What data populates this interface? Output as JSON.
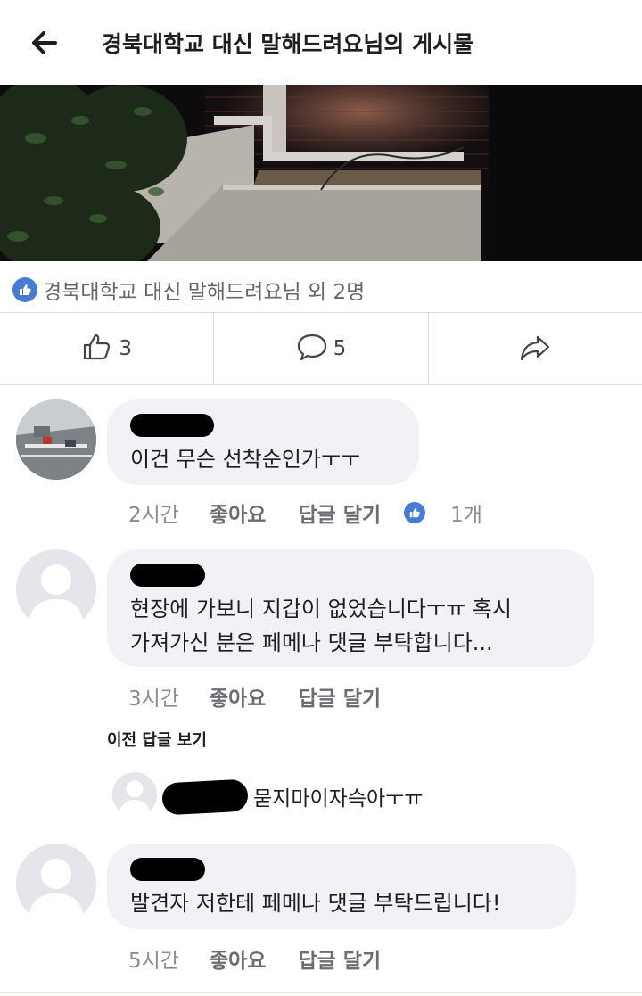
{
  "header": {
    "title": "경북대학교 대신 말해드려요님의 게시물"
  },
  "reactions": {
    "summary": "경북대학교 대신 말해드려요님 외 2명"
  },
  "actions": {
    "like_count": "3",
    "comment_count": "5"
  },
  "comments": [
    {
      "text": "이건 무슨 선착순인가ㅜㅜ",
      "time": "2시간",
      "like_label": "좋아요",
      "reply_label": "답글 달기",
      "like_count": "1개"
    },
    {
      "text_line1": "현장에 가보니 지갑이 없었습니다ㅜㅠ 혹시",
      "text_line2": "가져가신 분은 페메나 댓글 부탁합니다...",
      "time": "3시간",
      "like_label": "좋아요",
      "reply_label": "답글 달기"
    },
    {
      "text": "발견자 저한테 페메나 댓글 부탁드립니다!",
      "time": "5시간",
      "like_label": "좋아요",
      "reply_label": "답글 달기"
    }
  ],
  "replies": {
    "prev_label": "이전 답글 보기",
    "text": "묻지마이자슥아ㅜㅠ"
  },
  "icons": {
    "back": "arrow-left-icon",
    "like": "thumbs-up-icon",
    "comment": "speech-bubble-icon",
    "share": "share-arrow-icon"
  },
  "colors": {
    "accent": "#4a7bd0",
    "bubble": "#f0f2f5",
    "meta": "#8a8d91"
  }
}
